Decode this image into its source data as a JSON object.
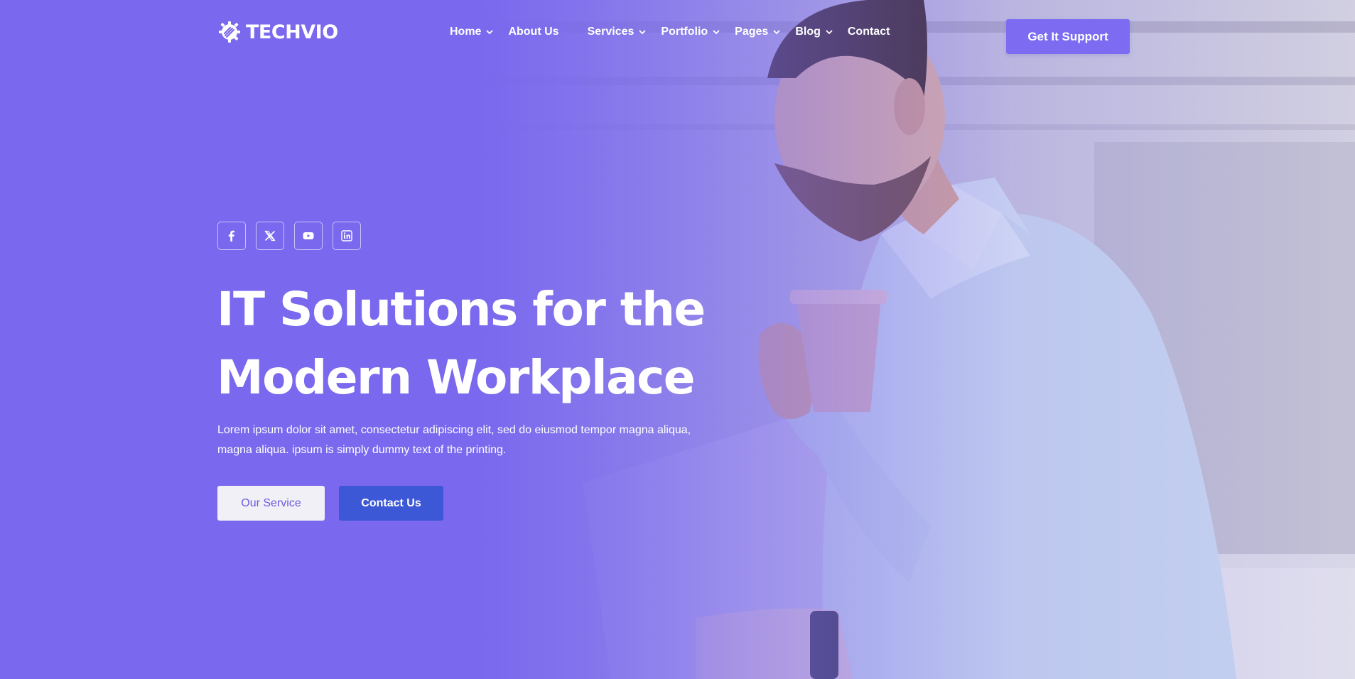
{
  "brand": {
    "name": "TECHVIO",
    "logo_icon": "gear-rocket-icon"
  },
  "nav": {
    "items": [
      {
        "label": "Home",
        "has_dropdown": true
      },
      {
        "label": "About Us",
        "has_dropdown": false
      },
      {
        "label": "Services",
        "has_dropdown": true
      },
      {
        "label": "Portfolio",
        "has_dropdown": true
      },
      {
        "label": "Pages",
        "has_dropdown": true
      },
      {
        "label": "Blog",
        "has_dropdown": true
      },
      {
        "label": "Contact",
        "has_dropdown": false
      }
    ]
  },
  "header": {
    "cta_label": "Get It Support"
  },
  "socials": [
    {
      "icon": "facebook-icon"
    },
    {
      "icon": "x-twitter-icon"
    },
    {
      "icon": "youtube-icon"
    },
    {
      "icon": "linkedin-icon"
    }
  ],
  "hero": {
    "title_line1": "IT Solutions for the",
    "title_line2": "Modern Workplace",
    "description_line1": "Lorem ipsum dolor sit amet, consectetur adipiscing elit, sed do eiusmod tempor magna aliqua,",
    "description_line2": "magna aliqua. ipsum is simply dummy text of the printing.",
    "primary_button": "Our Service",
    "secondary_button": "Contact Us"
  },
  "colors": {
    "accent": "#7a68ee",
    "cta": "#7d6cf1",
    "contact_button": "#3c58d6",
    "light_button": "#f1f0f6"
  }
}
